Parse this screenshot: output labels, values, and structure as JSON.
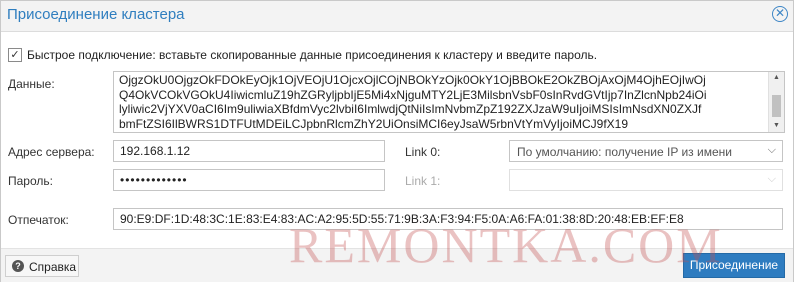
{
  "dialog": {
    "title": "Присоединение кластера"
  },
  "quick_connect": {
    "checked": true,
    "label": "Быстрое подключение: вставьте скопированные данные присоединения к кластеру и введите пароль."
  },
  "data_field": {
    "label": "Данные:",
    "lines": [
      "OjgzOkU0OjgzOkFDOkEyOjk1OjVEOjU1OjcxOjlCOjNBOkYzOjk0OkY1OjBBOkE2OkZBOjAxOjM4OjhEOjIwOj",
      "Q4OkVCOkVGOkU4IiwicmluZ19hZGRyljpbIjE5Mi4xNjguMTY2LjE3MilsbnVsbF0sInRvdGVtIjp7InZlcnNpb24iOi",
      "lyliwic2VjYXV0aCI6Im9uliwiaXBfdmVyc2lvbiI6ImlwdjQtNiIsImNvbmZpZ192ZXJzaW9uIjoiMSIsImNsdXN0ZXJf",
      "bmFtZSI6IlBWRS1DTFUtMDEiLCJpbnRlcmZhY2UiOnsiMCI6eyJsaW5rbnVtYmVyIjoiMCJ9fX19"
    ]
  },
  "server": {
    "label": "Адрес сервера:",
    "value": "192.168.1.12"
  },
  "password": {
    "label": "Пароль:",
    "value": "•••••••••••••"
  },
  "link0": {
    "label": "Link 0:",
    "value": "По умолчанию: получение IP из имени"
  },
  "link1": {
    "label": "Link 1:",
    "value": ""
  },
  "fingerprint": {
    "label": "Отпечаток:",
    "value": "90:E9:DF:1D:48:3C:1E:83:E4:83:AC:A2:95:5D:55:71:9B:3A:F3:94:F5:0A:A6:FA:01:38:8D:20:48:EB:EF:E8"
  },
  "footer": {
    "help_label": "Справка",
    "join_label": "Присоединение"
  },
  "watermark": "REMONTKA.COM",
  "icons": {
    "close": "close-circle-icon",
    "help": "help-circle-icon",
    "check": "checkmark-icon"
  }
}
